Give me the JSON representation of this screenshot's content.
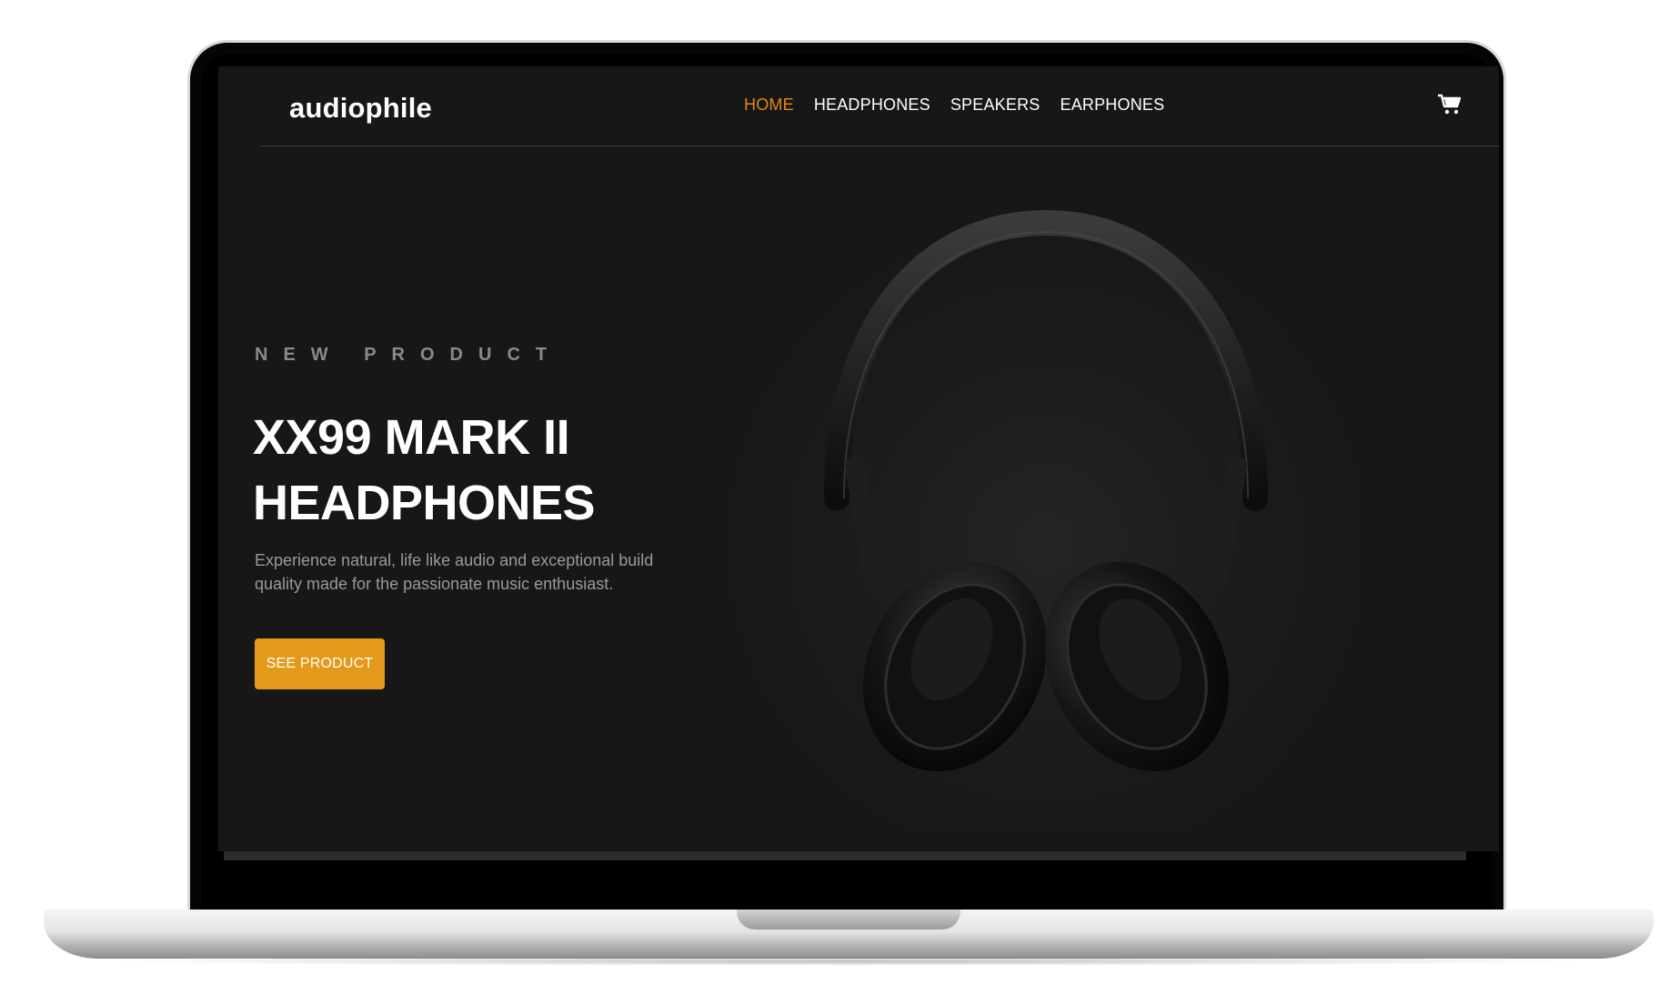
{
  "nav": {
    "logo": "audiophile",
    "links": [
      "HOME",
      "HEADPHONES",
      "SPEAKERS",
      "EARPHONES"
    ],
    "active": "HOME",
    "cart_icon": "cart-icon"
  },
  "hero": {
    "overline": "NEW PRODUCT",
    "title_line1": "XX99 MARK II",
    "title_line2": "HEADPHONES",
    "description": "Experience natural, life like audio and exceptional build quality made for the passionate music enthusiast.",
    "cta_label": "SEE PRODUCT"
  },
  "colors": {
    "background": "#171717",
    "accent": "#e39a1a",
    "active_link": "#e3871b",
    "text": "#ffffff",
    "muted_text": "#9a9a9a"
  }
}
